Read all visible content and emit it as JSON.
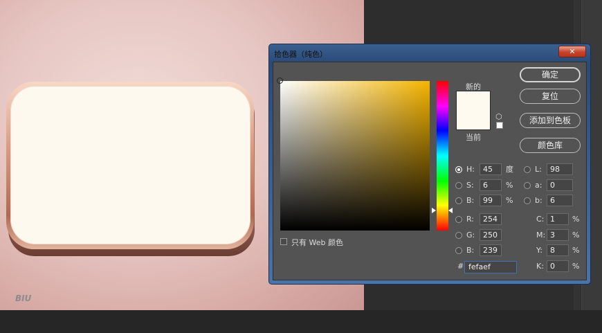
{
  "dialog": {
    "title": "拾色器（纯色）",
    "close_icon": "✕",
    "buttons": {
      "ok": "确定",
      "reset": "复位",
      "add_swatch": "添加到色板",
      "libraries": "颜色库"
    },
    "new_label": "新的",
    "current_label": "当前",
    "new_color": "#fefaef",
    "web_only_label": "只有 Web 颜色",
    "hsb": {
      "h_label": "H:",
      "h_value": "45",
      "h_unit": "度",
      "s_label": "S:",
      "s_value": "6",
      "s_unit": "%",
      "b_label": "B:",
      "b_value": "99",
      "b_unit": "%"
    },
    "lab": {
      "l_label": "L:",
      "l_value": "98",
      "a_label": "a:",
      "a_value": "0",
      "b_label": "b:",
      "b_value": "6"
    },
    "rgb": {
      "r_label": "R:",
      "r_value": "254",
      "g_label": "G:",
      "g_value": "250",
      "b_label": "B:",
      "b_value": "239"
    },
    "cmyk": {
      "c_label": "C:",
      "c_value": "1",
      "m_label": "M:",
      "m_value": "3",
      "y_label": "Y:",
      "y_value": "8",
      "k_label": "K:",
      "k_value": "0",
      "unit": "%"
    },
    "hex_label": "#",
    "hex_value": "fefaef",
    "hue_color": "#f5b400"
  },
  "canvas": {
    "watermark": "BIU"
  }
}
